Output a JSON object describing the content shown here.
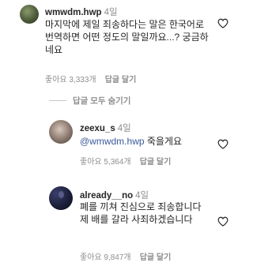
{
  "comments": [
    {
      "username": "wmwdm.hwp",
      "time": "4일",
      "text": "마지막에 제일 죄송하다는 말은 한국어로 번역하면 어떤 정도의 말일까요...? 궁금하네요",
      "likes": "좋아요 3,333개",
      "reply": "답글 달기"
    },
    {
      "username": "zeexu_s",
      "time": "4일",
      "mention": "@wmwdm.hwp",
      "text": " 죽을게요",
      "likes": "좋아요 5,364개",
      "reply": "답글 달기"
    },
    {
      "username": "already__no",
      "time": "4일",
      "text": "폐를 끼쳐 진심으로 죄송합니다 제 배를 갈라 사죄하겠습니다",
      "likes": "좋아요 9,847개",
      "reply": "답글 달기"
    }
  ],
  "replies_toggle": "답글 모두 숨기기",
  "icons": {
    "like": "heart-outline-icon"
  }
}
